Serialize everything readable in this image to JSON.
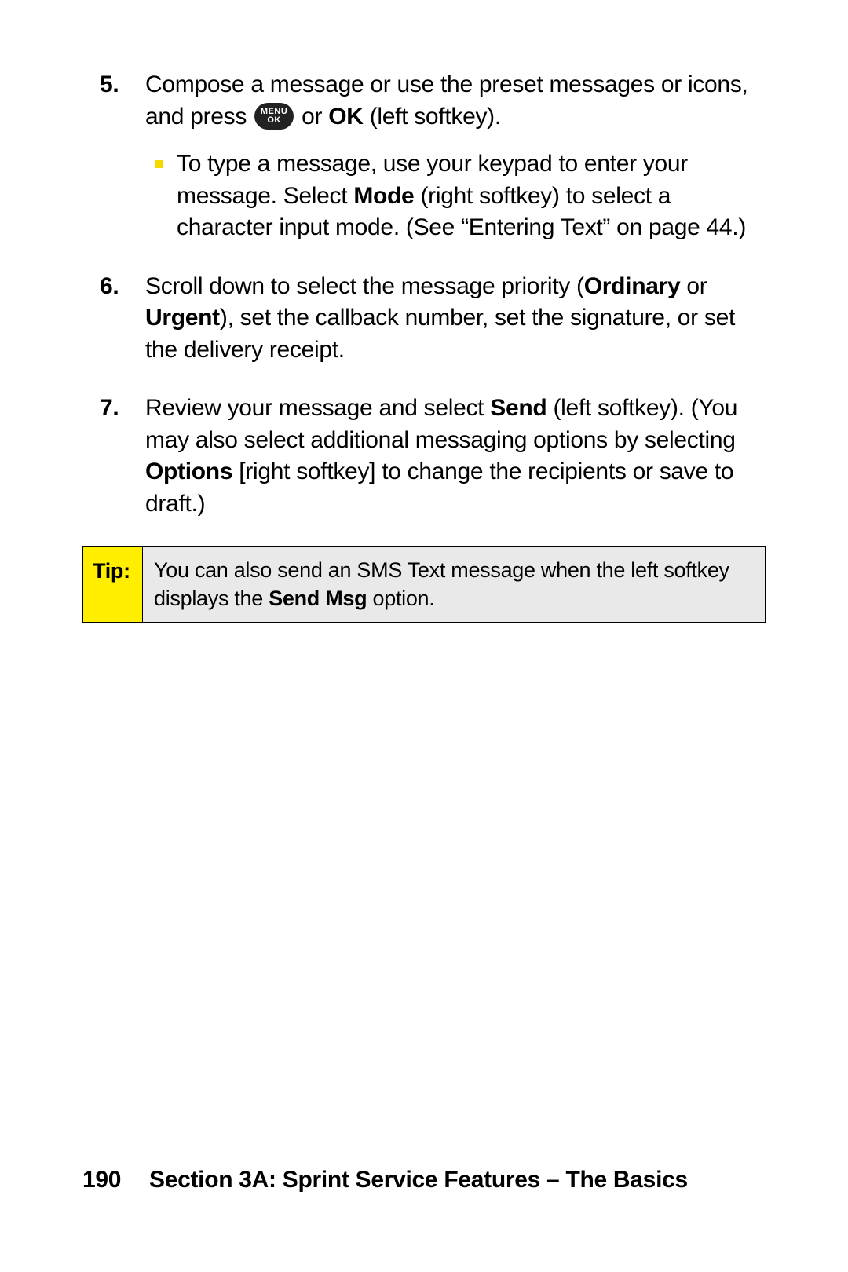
{
  "steps": {
    "s5": {
      "num": "5.",
      "text_a": "Compose a message or use the preset messages or icons, and press ",
      "text_b": " or ",
      "ok": "OK",
      "text_c": " (left softkey).",
      "sub": {
        "a": "To type a message, use your keypad to enter your message. Select ",
        "mode": "Mode",
        "b": " (right softkey) to select a character input mode. (See “Entering Text” on page 44.)"
      }
    },
    "s6": {
      "num": "6.",
      "a": "Scroll down to select the message priority (",
      "ordinary": "Ordinary",
      "b": " or ",
      "urgent": "Urgent",
      "c": "), set the callback number, set the signature, or set the delivery receipt."
    },
    "s7": {
      "num": "7.",
      "a": "Review your message and select ",
      "send": "Send",
      "b": " (left softkey). (You may also select additional messaging options by selecting ",
      "options": "Options",
      "c": " [right softkey] to change the recipients or save to draft.)"
    }
  },
  "icon": {
    "menu": "MENU",
    "ok": "OK"
  },
  "tip": {
    "label": "Tip:",
    "a": "You can also send an SMS Text message when the left softkey displays the ",
    "sendmsg": "Send Msg",
    "b": " option."
  },
  "footer": {
    "page": "190",
    "section": "Section 3A: Sprint Service Features – The Basics"
  }
}
